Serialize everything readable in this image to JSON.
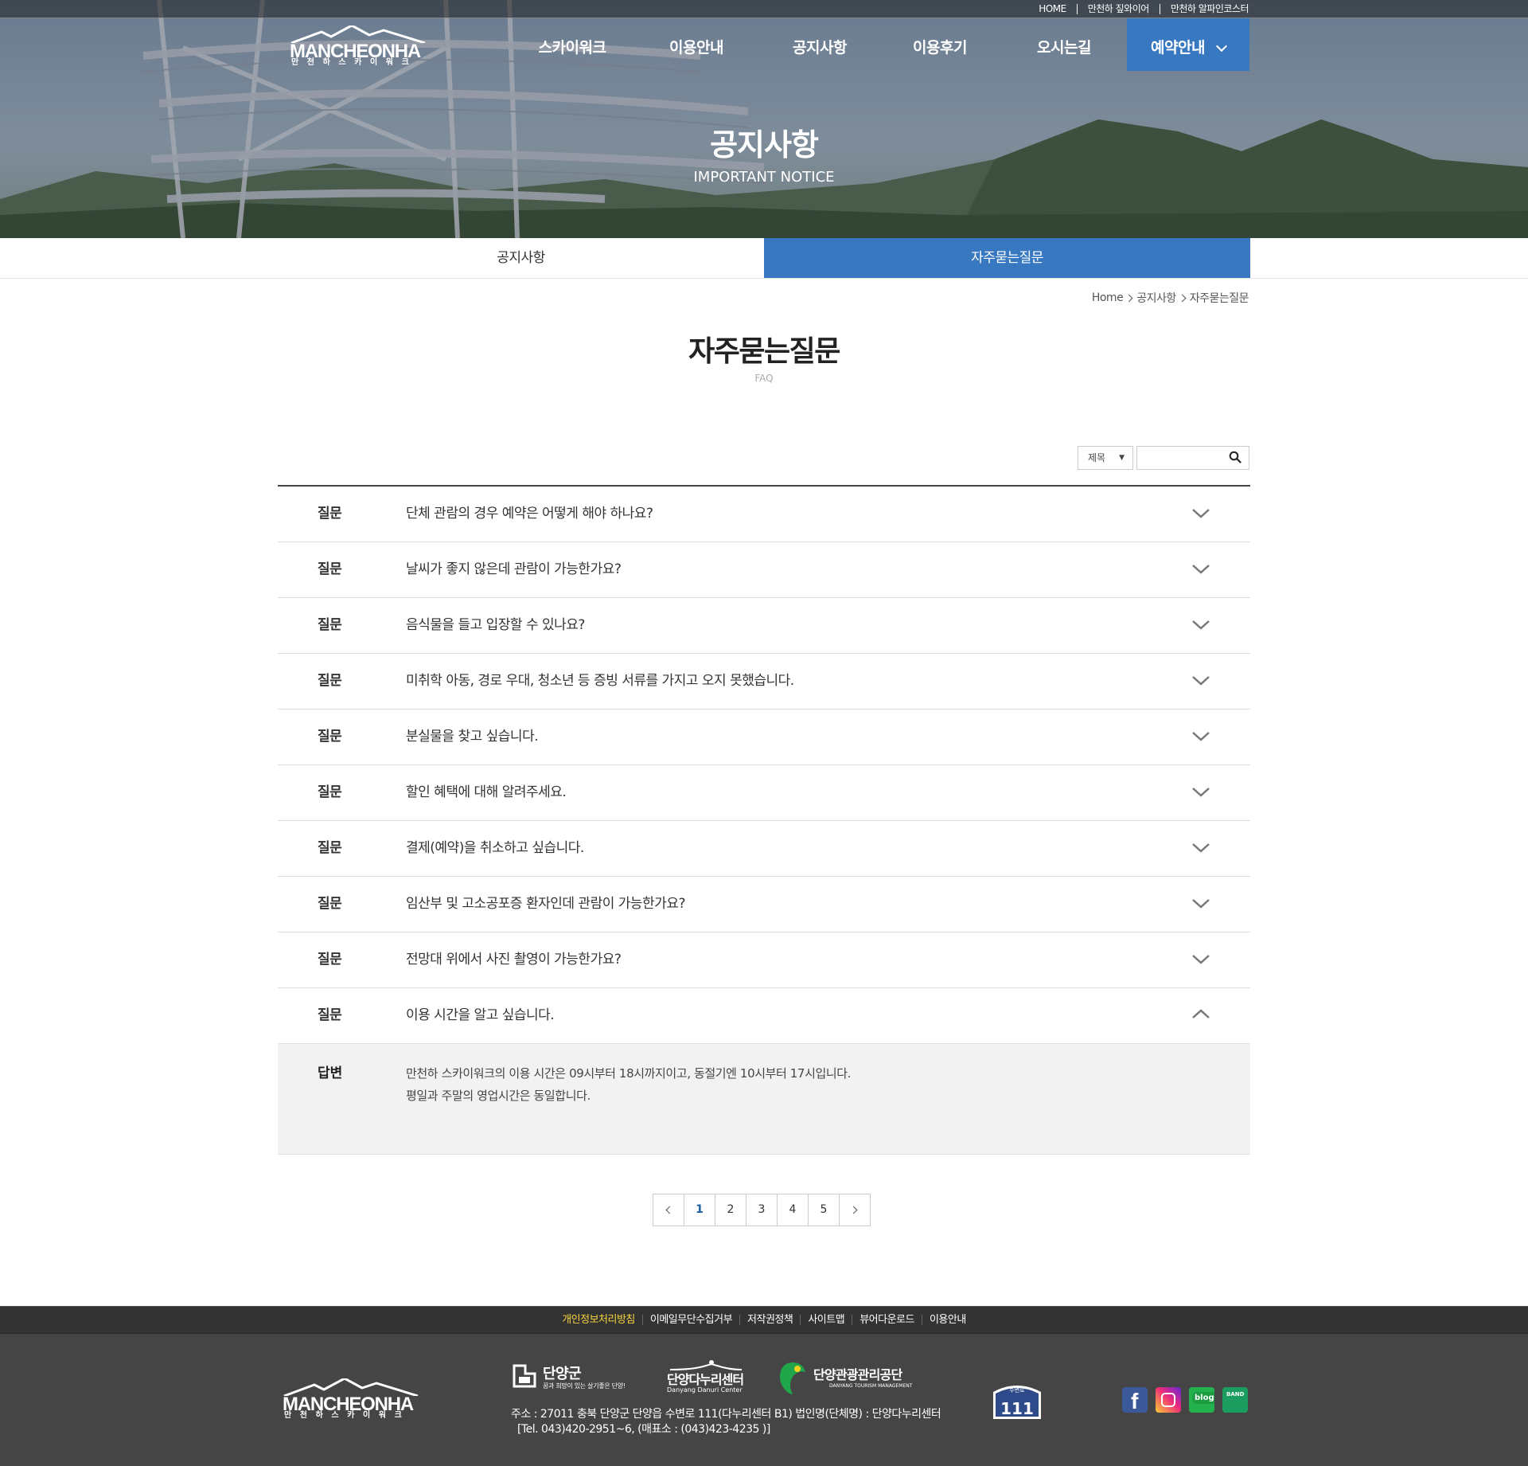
{
  "top_links": [
    "HOME",
    "만천하 짚와이어",
    "만천하 알파인코스터"
  ],
  "logo": {
    "brand": "MANCHEONHA",
    "sub": "만천하스카이워크"
  },
  "nav": [
    {
      "label": "스카이워크"
    },
    {
      "label": "이용안내"
    },
    {
      "label": "공지사항"
    },
    {
      "label": "이용후기"
    },
    {
      "label": "오시는길"
    },
    {
      "label": "예약안내",
      "active": true
    }
  ],
  "hero": {
    "title": "공지사항",
    "subtitle": "IMPORTANT NOTICE"
  },
  "sub_tabs": [
    {
      "label": "공지사항"
    },
    {
      "label": "자주묻는질문",
      "active": true
    }
  ],
  "breadcrumb": [
    "Home",
    "공지사항",
    "자주묻는질문"
  ],
  "page": {
    "title": "자주묻는질문",
    "subtitle": "FAQ"
  },
  "search": {
    "select_value": "제목",
    "input_value": "",
    "button_icon": "search-icon"
  },
  "faq": {
    "q_label": "질문",
    "a_label": "답변",
    "items": [
      {
        "question": "단체 관람의 경우 예약은 어떻게 해야 하나요?",
        "expanded": false
      },
      {
        "question": "날씨가 좋지 않은데 관람이 가능한가요?",
        "expanded": false
      },
      {
        "question": "음식물을 들고 입장할 수 있나요?",
        "expanded": false
      },
      {
        "question": "미취학 아동, 경로 우대, 청소년 등 증빙 서류를 가지고 오지 못했습니다.",
        "expanded": false
      },
      {
        "question": "분실물을 찾고 싶습니다.",
        "expanded": false
      },
      {
        "question": "할인 혜택에 대해 알려주세요.",
        "expanded": false
      },
      {
        "question": "결제(예약)을 취소하고 싶습니다.",
        "expanded": false
      },
      {
        "question": "임산부 및 고소공포증 환자인데 관람이 가능한가요?",
        "expanded": false
      },
      {
        "question": "전망대 위에서 사진 촬영이 가능한가요?",
        "expanded": false
      },
      {
        "question": "이용 시간을 알고 싶습니다.",
        "expanded": true,
        "answer": [
          "만천하 스카이워크의 이용 시간은 09시부터 18시까지이고, 동절기엔 10시부터 17시입니다.",
          "평일과 주말의 영업시간은 동일합니다."
        ]
      }
    ]
  },
  "pagination": {
    "pages": [
      "1",
      "2",
      "3",
      "4",
      "5"
    ],
    "current": "1"
  },
  "footer": {
    "links": [
      "개인정보처리방침",
      "이메일무단수집거부",
      "저작권정책",
      "사이트맵",
      "뷰어다운로드",
      "이용안내"
    ],
    "orgs": [
      {
        "name": "단양군",
        "slogan": "꿈과 희망이 있는 살기좋은 단양!"
      },
      {
        "name": "단양다누리센터",
        "slogan": "Danyang Danuri Center"
      },
      {
        "name": "단양관광관리공단",
        "slogan": "DANYANG TOURISM MANAGEMENT"
      }
    ],
    "address_line1": "주소 : 27011 충북 단양군 단양읍 수변로 111(다누리센터 B1) 법인명(단체명) : 단양다누리센터",
    "address_line2": "[Tel. 043)420-2951~6, (매표소 : (043)423-4235 )]",
    "badge": {
      "top": "수변로",
      "number": "111"
    },
    "sns": [
      "facebook-icon",
      "instagram-icon",
      "blog-icon",
      "band-icon"
    ]
  },
  "colors": {
    "accent": "#3878c1",
    "footer_bg": "#454545",
    "footer_link_highlight": "#f6d43f"
  }
}
